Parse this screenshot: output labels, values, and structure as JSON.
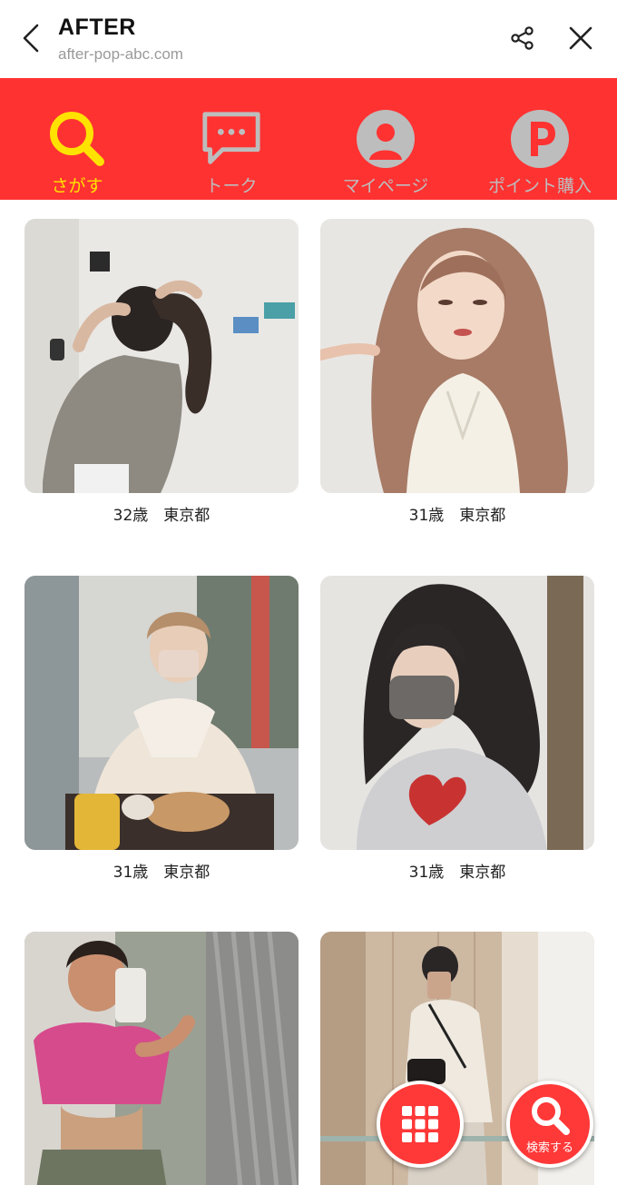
{
  "header": {
    "title": "AFTER",
    "url": "after-pop-abc.com"
  },
  "nav": {
    "items": [
      {
        "label": "さがす",
        "icon": "search-icon",
        "active": true
      },
      {
        "label": "トーク",
        "icon": "chat-bubble-icon",
        "active": false
      },
      {
        "label": "マイページ",
        "icon": "profile-icon",
        "active": false
      },
      {
        "label": "ポイント購入",
        "icon": "point-icon",
        "active": false
      }
    ]
  },
  "profiles": [
    {
      "age": "32歳",
      "location": "東京都",
      "caption": "32歳　東京都"
    },
    {
      "age": "31歳",
      "location": "東京都",
      "caption": "31歳　東京都"
    },
    {
      "age": "31歳",
      "location": "東京都",
      "caption": "31歳　東京都"
    },
    {
      "age": "31歳",
      "location": "東京都",
      "caption": "31歳　東京都"
    },
    {
      "age": "",
      "location": "",
      "caption": ""
    },
    {
      "age": "",
      "location": "",
      "caption": ""
    }
  ],
  "fabs": {
    "grid": {
      "icon": "grid-icon"
    },
    "search": {
      "label": "検索する",
      "icon": "search-icon"
    }
  },
  "colors": {
    "nav_bg": "#ff3232",
    "nav_active": "#ffe200",
    "nav_inactive": "#bdbdbd",
    "fab_bg": "#ff3838"
  }
}
